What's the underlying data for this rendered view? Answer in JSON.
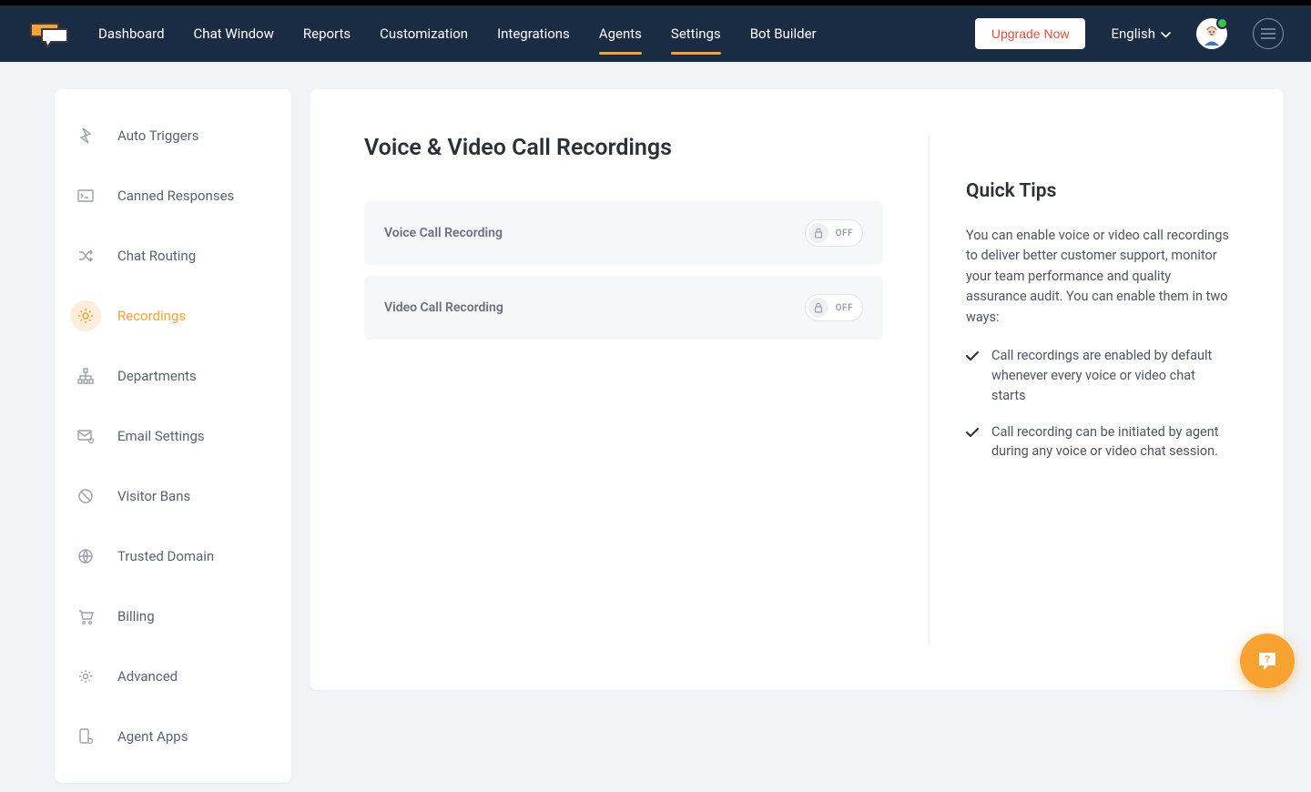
{
  "header": {
    "nav": [
      {
        "label": "Dashboard",
        "active": false
      },
      {
        "label": "Chat Window",
        "active": false
      },
      {
        "label": "Reports",
        "active": false
      },
      {
        "label": "Customization",
        "active": false
      },
      {
        "label": "Integrations",
        "active": false
      },
      {
        "label": "Agents",
        "active": true
      },
      {
        "label": "Settings",
        "active": true
      },
      {
        "label": "Bot Builder",
        "active": false
      }
    ],
    "upgrade_label": "Upgrade Now",
    "language": "English"
  },
  "sidebar": {
    "items": [
      {
        "label": "Auto Triggers"
      },
      {
        "label": "Canned Responses"
      },
      {
        "label": "Chat Routing"
      },
      {
        "label": "Recordings"
      },
      {
        "label": "Departments"
      },
      {
        "label": "Email Settings"
      },
      {
        "label": "Visitor Bans"
      },
      {
        "label": "Trusted Domain"
      },
      {
        "label": "Billing"
      },
      {
        "label": "Advanced"
      },
      {
        "label": "Agent Apps"
      }
    ]
  },
  "main": {
    "title": "Voice & Video Call Recordings",
    "settings": [
      {
        "label": "Voice Call Recording",
        "state": "OFF"
      },
      {
        "label": "Video Call Recording",
        "state": "OFF"
      }
    ],
    "tips": {
      "title": "Quick Tips",
      "intro": "You can enable voice or video call recordings to deliver better customer support, monitor your team performance and quality assurance audit. You can enable them in two ways:",
      "bullets": [
        "Call recordings are enabled by default whenever every voice or video chat starts",
        "Call recording can be initiated by agent during any voice or video chat session."
      ]
    }
  }
}
